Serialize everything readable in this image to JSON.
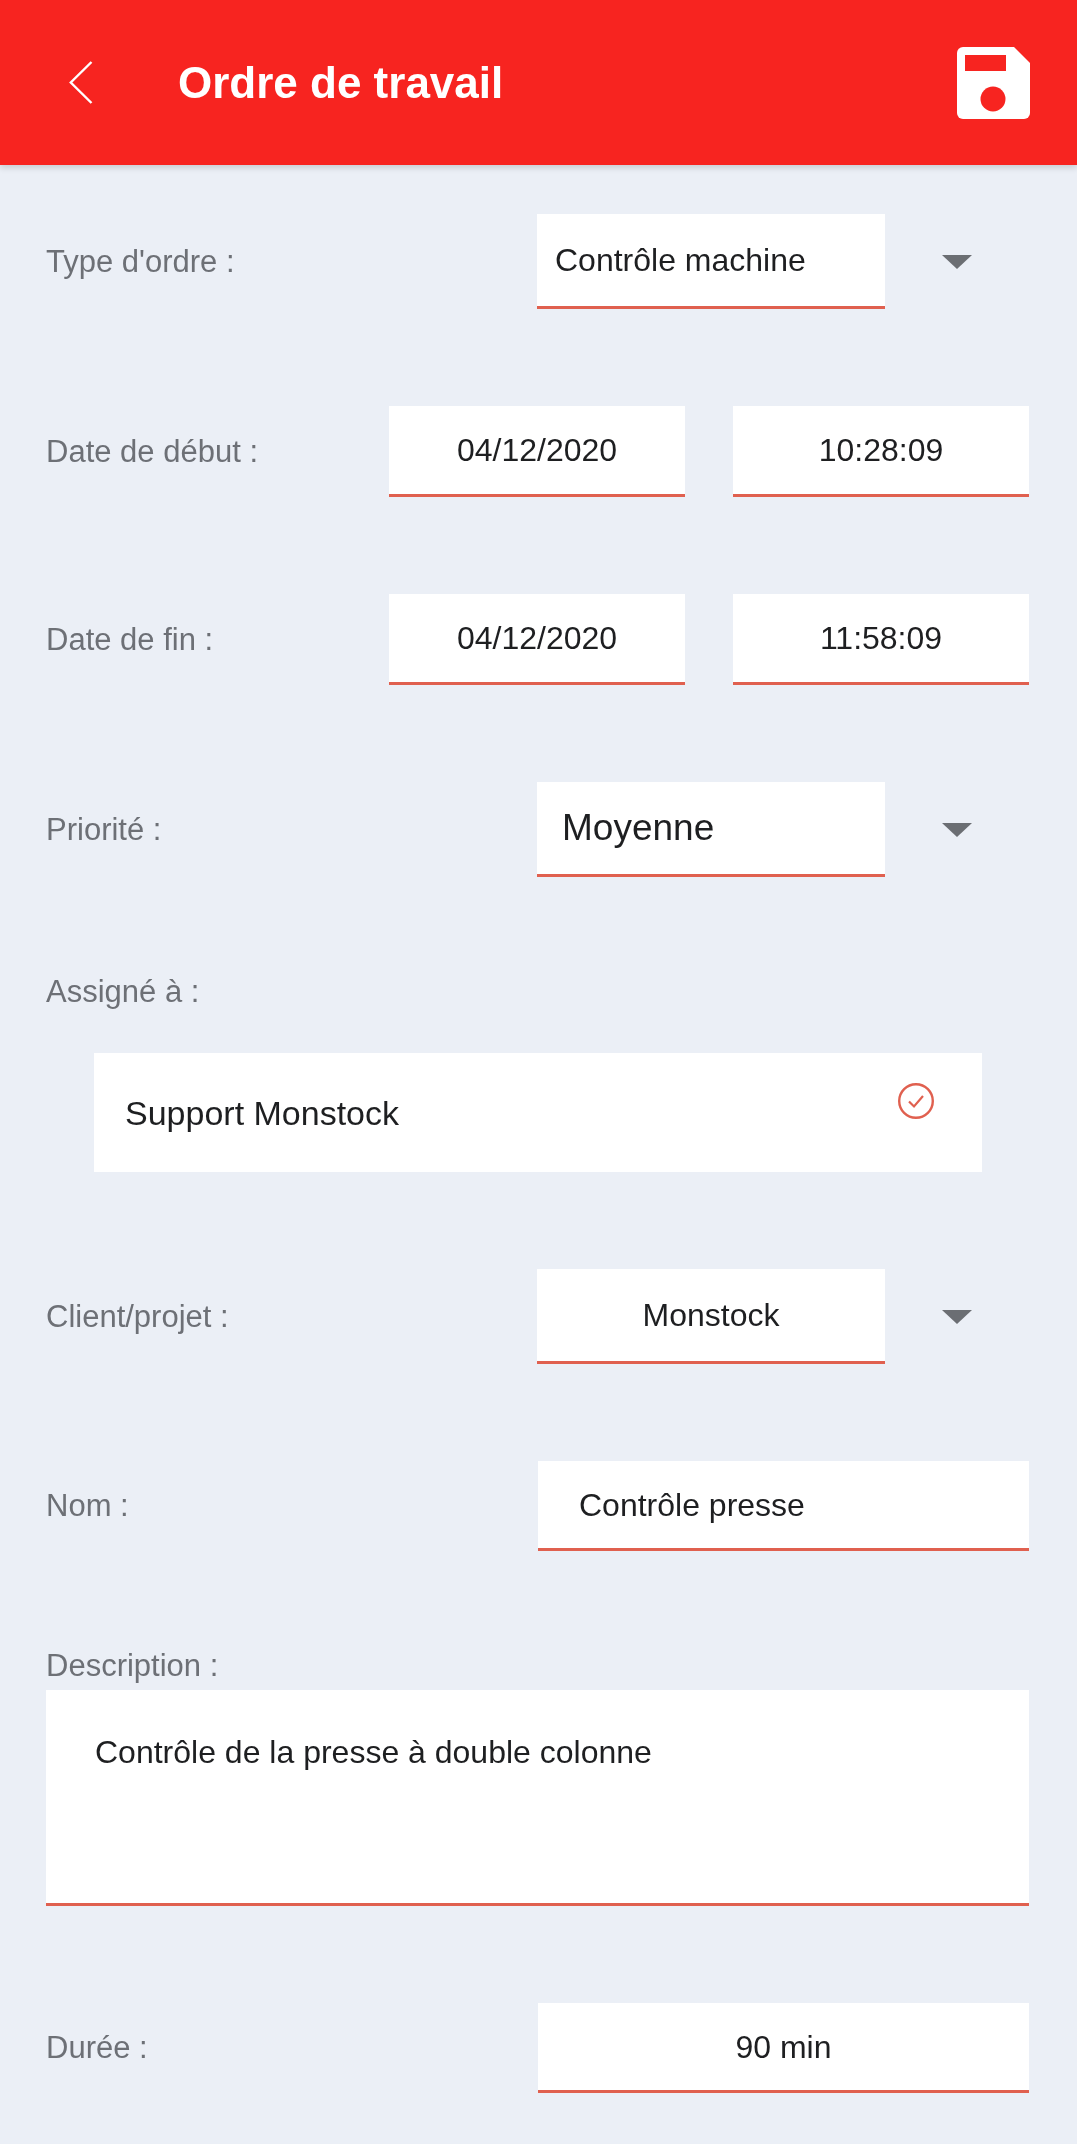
{
  "app_bar": {
    "title": "Ordre de travail"
  },
  "fields": [
    {
      "kind": "dropdown",
      "label": "Type d'ordre :",
      "value": "Contrôle machine"
    },
    {
      "kind": "datetime",
      "label": "Date de début :",
      "date": "04/12/2020",
      "time": "10:28:09"
    },
    {
      "kind": "datetime",
      "label": "Date de fin :",
      "date": "04/12/2020",
      "time": "11:58:09"
    },
    {
      "kind": "dropdown",
      "label": "Priorité :",
      "value": "Moyenne"
    },
    {
      "kind": "assignee",
      "label": "Assigné à :",
      "value": "Support Monstock",
      "checked": true
    },
    {
      "kind": "dropdown",
      "label": "Client/projet :",
      "value": "Monstock"
    },
    {
      "kind": "text",
      "label": "Nom :",
      "value": "Contrôle presse"
    },
    {
      "kind": "textarea",
      "label": "Description :",
      "value": "Contrôle de la presse à double colonne"
    },
    {
      "kind": "text",
      "label": "Durée :",
      "value": "90 min"
    }
  ]
}
